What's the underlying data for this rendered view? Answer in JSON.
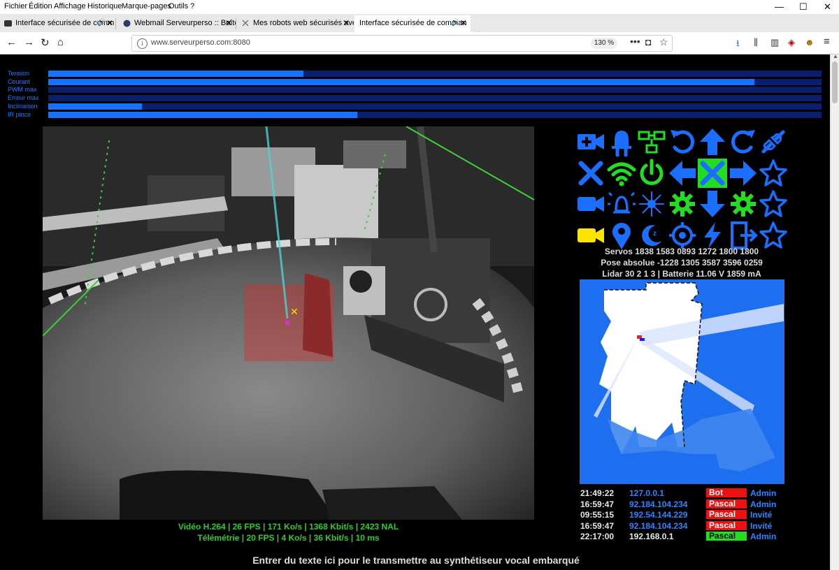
{
  "menu": [
    "Fichier",
    "Édition",
    "Affichage",
    "Historique",
    "Marque-pages",
    "Outils",
    "?"
  ],
  "window_controls": {
    "minimize": "—",
    "maximize": "☐",
    "close": "✕"
  },
  "tabs": [
    {
      "label": "Interface sécurisée de comm",
      "audio": true,
      "active": false
    },
    {
      "label": "Webmail Serveurperso :: Boîte d",
      "audio": false,
      "active": false
    },
    {
      "label": "Mes robots web sécurisés avec",
      "audio": false,
      "active": false
    },
    {
      "label": "Interface sécurisée de comman",
      "audio": true,
      "active": true
    }
  ],
  "new_tab": "+",
  "nav": {
    "back": "←",
    "forward": "→",
    "reload": "↻",
    "home": "⌂"
  },
  "address": {
    "info": "i",
    "url": "www.serveurperso.com:8080",
    "zoom": "130 %",
    "more": "•••",
    "pocket": "◘",
    "bookmark": "☆"
  },
  "toolbar_icons": [
    "download-icon",
    "library-icon",
    "sidebar-icon",
    "ublock-icon",
    "extension-icon",
    "menu-icon"
  ],
  "toolbar_glyphs": {
    "download": "⭳",
    "library": "⫼",
    "sidebar": "▥",
    "ublock": "◈",
    "extension": "☻",
    "menu": "≡"
  },
  "gauges": [
    {
      "label": "Tension",
      "fill": 0.33
    },
    {
      "label": "Courant",
      "fill": 0.913
    },
    {
      "label": "PWM max",
      "fill": 0.0
    },
    {
      "label": "Erreur max",
      "fill": 0.0
    },
    {
      "label": "Inclinaison",
      "fill": 0.121
    },
    {
      "label": "IR pince",
      "fill": 0.4
    }
  ],
  "video": {
    "caption_line1": "Vidéo H.264 | 26 FPS | 171 Ko/s | 1368 Kbit/s | 2423 NAL",
    "caption_line2": "Télémétrie | 20 FPS | 4 Ko/s | 36 Kbit/s | 10 ms"
  },
  "controls": [
    {
      "name": "camera-add-icon",
      "active": false
    },
    {
      "name": "led-icon",
      "active": false
    },
    {
      "name": "network-icon",
      "active": false
    },
    {
      "name": "rotate-left-icon",
      "active": false
    },
    {
      "name": "arrow-up-icon",
      "active": false
    },
    {
      "name": "rotate-right-icon",
      "active": false
    },
    {
      "name": "plug-icon",
      "active": false
    },
    {
      "name": "close-icon",
      "active": false
    },
    {
      "name": "wifi-icon",
      "active": true
    },
    {
      "name": "power-icon",
      "active": true
    },
    {
      "name": "arrow-left-icon",
      "active": false
    },
    {
      "name": "stop-icon",
      "active": true
    },
    {
      "name": "arrow-right-icon",
      "active": false
    },
    {
      "name": "star-icon",
      "active": false
    },
    {
      "name": "video-camera-icon",
      "active": false
    },
    {
      "name": "alarm-icon",
      "active": false
    },
    {
      "name": "laser-icon",
      "active": false
    },
    {
      "name": "gear-icon",
      "active": true
    },
    {
      "name": "arrow-down-icon",
      "active": false
    },
    {
      "name": "gear-icon",
      "active": true
    },
    {
      "name": "star-icon",
      "active": false
    },
    {
      "name": "video-camera-icon",
      "active": true
    },
    {
      "name": "location-pin-icon",
      "active": false
    },
    {
      "name": "sleep-icon",
      "active": false
    },
    {
      "name": "crosshair-icon",
      "active": false
    },
    {
      "name": "lightning-icon",
      "active": false
    },
    {
      "name": "exit-icon",
      "active": false
    },
    {
      "name": "star-icon",
      "active": false
    }
  ],
  "robot": {
    "servos": "Servos 1838 1583 0893 1272 1800 1800",
    "pose": "Pose absolue -1228 1305 3587 3596 0259",
    "lidar": "Lidar 30 2 1 3 | Batterie 11.06 V 1859 mA"
  },
  "connections": [
    {
      "time": "21:49:22",
      "ip": "127.0.0.1",
      "name": "Bot",
      "name_color": "#ee1111",
      "role": "Admin",
      "local": false
    },
    {
      "time": "16:59:47",
      "ip": "92.184.104.234",
      "name": "Pascal",
      "name_color": "#ee1111",
      "role": "Admin",
      "local": false
    },
    {
      "time": "09:55:15",
      "ip": "192.54.144.229",
      "name": "Pascal",
      "name_color": "#ee1111",
      "role": "Invité",
      "local": false
    },
    {
      "time": "16:59:47",
      "ip": "92.184.104.234",
      "name": "Pascal",
      "name_color": "#ee1111",
      "role": "Invité",
      "local": false
    },
    {
      "time": "22:17:00",
      "ip": "192.168.0.1",
      "name": "Pascal",
      "name_color": "#22dd22",
      "role": "Admin",
      "local": true
    }
  ],
  "tts_prompt": "Entrer du texte ici pour le transmettre au synthétiseur vocal embarqué",
  "colors": {
    "blue": "#1772ff",
    "green": "#2ecc2e",
    "yellow": "#ffe400",
    "map_blue": "#1e6ef0"
  }
}
